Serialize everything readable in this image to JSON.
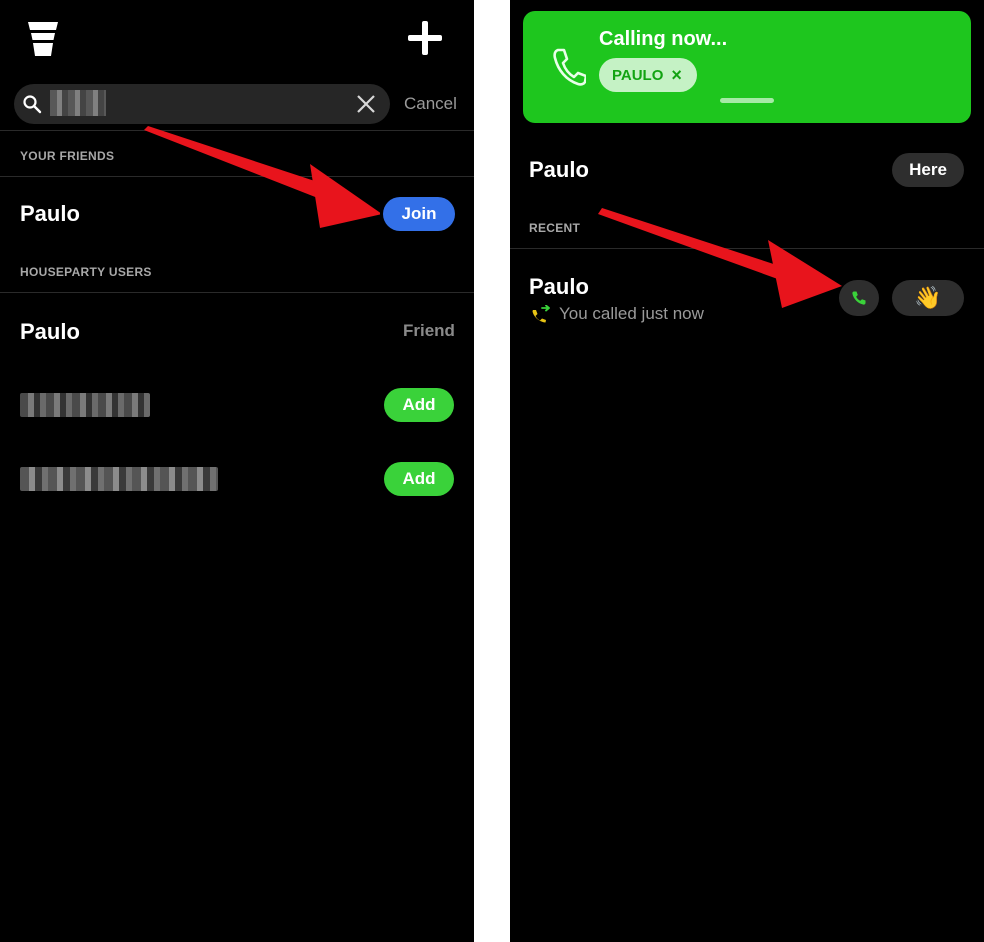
{
  "left": {
    "header": {
      "cup_icon": "cup-icon",
      "add_icon": "plus-icon"
    },
    "search": {
      "value": "",
      "clear_icon": "close-icon",
      "cancel_label": "Cancel"
    },
    "your_friends": {
      "label": "YOUR FRIENDS",
      "items": [
        {
          "name": "Paulo",
          "action": "Join"
        }
      ]
    },
    "houseparty_users": {
      "label": "HOUSEPARTY USERS",
      "items": [
        {
          "name": "Paulo",
          "status": "Friend"
        },
        {
          "name": "",
          "action": "Add"
        },
        {
          "name": "",
          "action": "Add"
        }
      ]
    }
  },
  "right": {
    "banner": {
      "title": "Calling now...",
      "chip_label": "PAULO",
      "chip_close": "×"
    },
    "here": {
      "name": "Paulo",
      "action": "Here"
    },
    "recent": {
      "label": "RECENT",
      "items": [
        {
          "name": "Paulo",
          "detail": "You called just now",
          "wave": "👋"
        }
      ]
    }
  },
  "colors": {
    "background": "#000000",
    "join_button": "#3370e8",
    "add_button": "#3ad23a",
    "calling_banner": "#1ec61e",
    "annotation_arrow": "#e8141c"
  }
}
